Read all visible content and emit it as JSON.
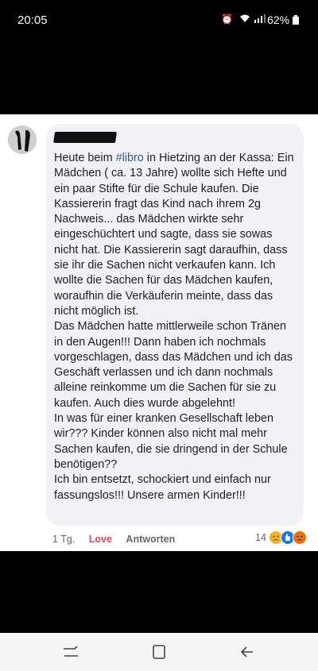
{
  "status_bar": {
    "time": "20:05",
    "status_icons": [
      "alarm-icon",
      "wifi-icon",
      "signal-icon"
    ],
    "battery": "62%"
  },
  "comment": {
    "hashtag": "#libro",
    "text_before_hashtag": "Heute beim ",
    "text_after_hashtag": " in Hietzing an der Kassa: Ein Mädchen ( ca. 13 Jahre) wollte sich Hefte und ein paar Stifte für die Schule kaufen. Die Kassiererin fragt das Kind nach ihrem 2g Nachweis... das Mädchen wirkte sehr eingeschüchtert und sagte, dass sie sowas nicht hat. Die Kassiererin sagt daraufhin, dass sie ihr die Sachen nicht verkaufen kann. Ich wollte die Sachen für das Mädchen kaufen, woraufhin die Verkäuferin meinte, dass das nicht möglich ist.\nDas Mädchen hatte mittlerweile schon Tränen in den Augen!!! Dann haben ich nochmals vorgeschlagen, dass das Mädchen und ich das Geschäft verlassen und ich dann nochmals alleine reinkomme um die Sachen für sie zu kaufen. Auch dies wurde abgelehnt!\nIn was für einer kranken Gesellschaft leben wir??? Kinder können also nicht mal mehr Sachen kaufen, die sie dringend in der Schule benötigen??\nIch bin entsetzt, schockiert und einfach nur fassungslos!!! Unsere armen Kinder!!!",
    "time_ago": "1 Tg.",
    "love_label": "Love",
    "reply_label": "Antworten",
    "reaction_count": "14",
    "reaction_icons": [
      "sad-reaction-icon",
      "like-reaction-icon",
      "angry-reaction-icon"
    ]
  },
  "nav_bar": {
    "buttons": [
      "recent-apps-icon",
      "home-icon",
      "back-icon"
    ]
  },
  "colors": {
    "hashtag": "#385898",
    "love": "#f33e58",
    "bubble": "#f0f2f5"
  }
}
